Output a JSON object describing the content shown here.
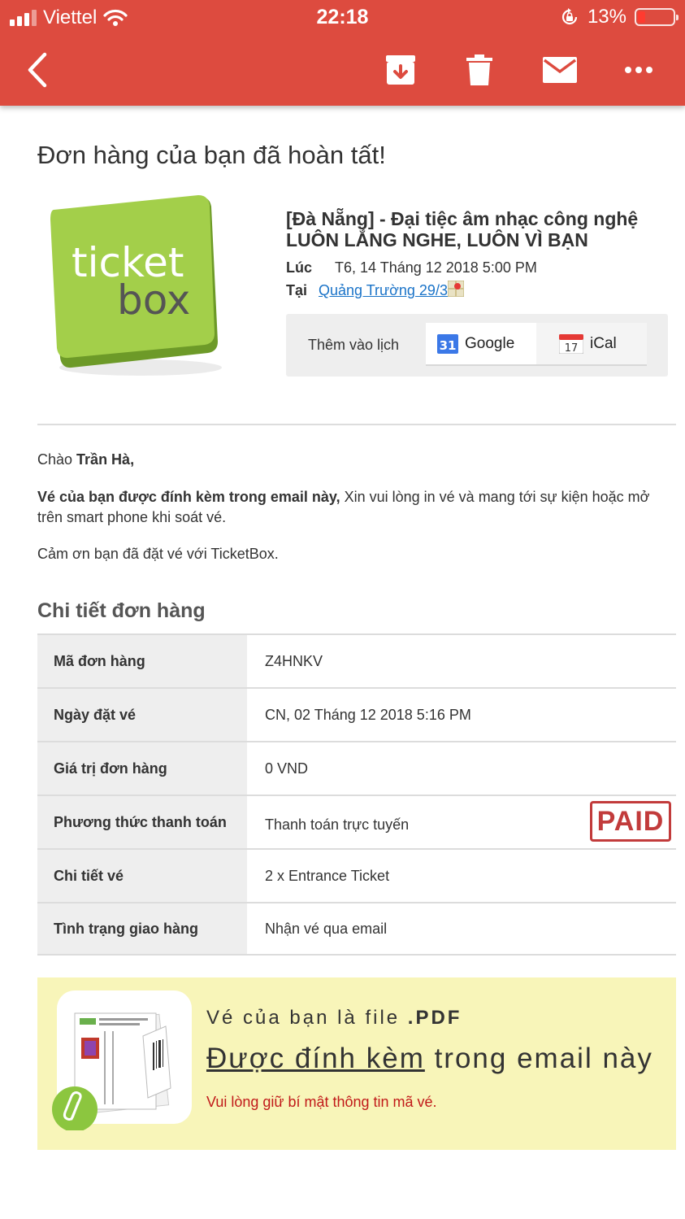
{
  "status_bar": {
    "carrier": "Viettel",
    "time": "22:18",
    "battery": "13%",
    "battery_level": 0.13
  },
  "toolbar": {
    "back_icon": "chevron-left-icon",
    "archive_icon": "archive-icon",
    "delete_icon": "trash-icon",
    "mail_icon": "mail-icon",
    "more_icon": "more-dots-icon",
    "color": "#dd4b3f"
  },
  "email": {
    "heading": "Đơn hàng của bạn đã hoàn tất!",
    "logo_text_1": "ticket",
    "logo_text_2": "box",
    "event": {
      "title": "[Đà Nẵng] - Đại tiệc âm nhạc công nghệ LUÔN LẮNG NGHE, LUÔN VÌ BẠN",
      "time_label": "Lúc",
      "time_value": "T6, 14 Tháng 12 2018 5:00 PM",
      "place_label": "Tại",
      "place_value": "Quảng Trường 29/3"
    },
    "calendar": {
      "label": "Thêm vào lịch",
      "google_label": "Google",
      "google_day": "31",
      "ical_label": "iCal",
      "ical_day": "17"
    },
    "greeting_prefix": "Chào",
    "greeting_name": "Trần Hà,",
    "attached_bold": "Vé của bạn được đính kèm trong email này,",
    "attached_rest": " Xin vui lòng in vé và mang tới sự kiện hoặc mở trên smart phone khi soát vé.",
    "thanks": "Cảm ơn bạn đã đặt vé với TicketBox.",
    "details_title": "Chi tiết đơn hàng",
    "details": [
      {
        "key": "Mã đơn hàng",
        "value": "Z4HNKV"
      },
      {
        "key": "Ngày đặt vé",
        "value": "CN, 02 Tháng 12 2018 5:16 PM"
      },
      {
        "key": "Giá trị đơn hàng",
        "value": "0 VND"
      },
      {
        "key": "Phương thức thanh toán",
        "value": "Thanh toán trực tuyến"
      },
      {
        "key": "Chi tiết vé",
        "value": "2 x Entrance Ticket"
      },
      {
        "key": "Tình trạng giao hàng",
        "value": "Nhận vé qua email"
      }
    ],
    "paid_stamp": "PAID",
    "pdf": {
      "line1_prefix": "Vé của bạn là file ",
      "line1_bold": ".PDF",
      "line2_underlined": "Được đính kèm",
      "line2_rest": " trong email này",
      "line3": "Vui lòng giữ bí mật thông tin mã vé."
    }
  }
}
